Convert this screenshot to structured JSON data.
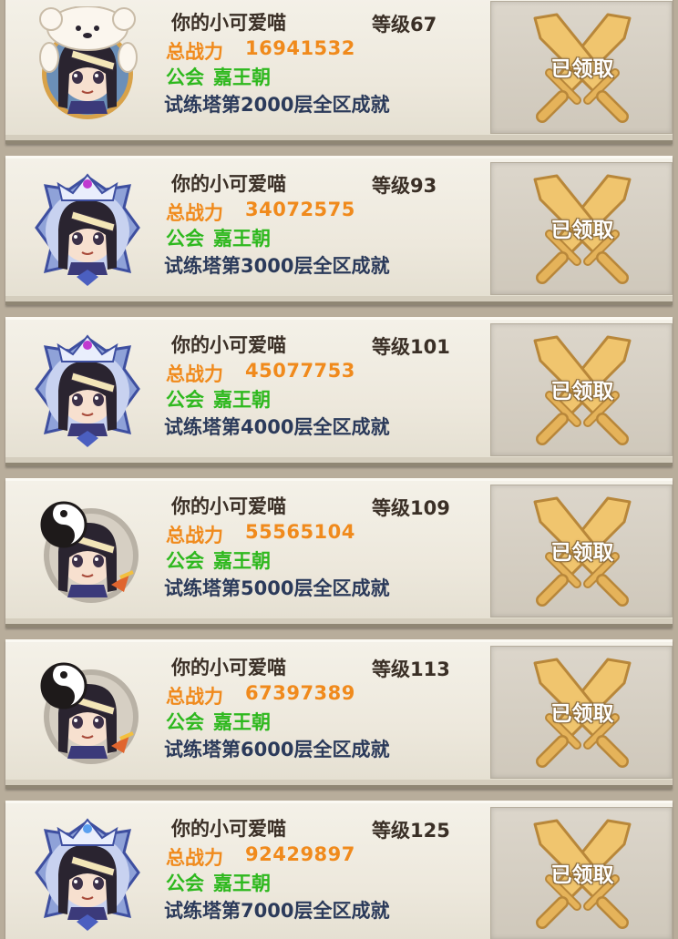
{
  "colors": {
    "name": "#3a2f26",
    "power": "#f08a1c",
    "guild": "#2eb81e",
    "achievement": "#2b3a5a",
    "button_gold": "#e8c06a"
  },
  "labels": {
    "power": "总战力",
    "guild": "公会",
    "claimed": "已领取"
  },
  "entries": [
    {
      "name": "你的小可爱喵",
      "level": "等级67",
      "power": "16941532",
      "guild": "嘉王朝",
      "achievement": "试练塔第2000层全区成就",
      "frame": "bear-hat-frame-icon"
    },
    {
      "name": "你的小可爱喵",
      "level": "等级93",
      "power": "34072575",
      "guild": "嘉王朝",
      "achievement": "试练塔第3000层全区成就",
      "frame": "crown-frame-icon"
    },
    {
      "name": "你的小可爱喵",
      "level": "等级101",
      "power": "45077753",
      "guild": "嘉王朝",
      "achievement": "试练塔第4000层全区成就",
      "frame": "crown-frame-icon"
    },
    {
      "name": "你的小可爱喵",
      "level": "等级109",
      "power": "55565104",
      "guild": "嘉王朝",
      "achievement": "试练塔第5000层全区成就",
      "frame": "yin-yang-frame-icon"
    },
    {
      "name": "你的小可爱喵",
      "level": "等级113",
      "power": "67397389",
      "guild": "嘉王朝",
      "achievement": "试练塔第6000层全区成就",
      "frame": "yin-yang-frame-icon"
    },
    {
      "name": "你的小可爱喵",
      "level": "等级125",
      "power": "92429897",
      "guild": "嘉王朝",
      "achievement": "试练塔第7000层全区成就",
      "frame": "star-crown-frame-icon"
    }
  ]
}
